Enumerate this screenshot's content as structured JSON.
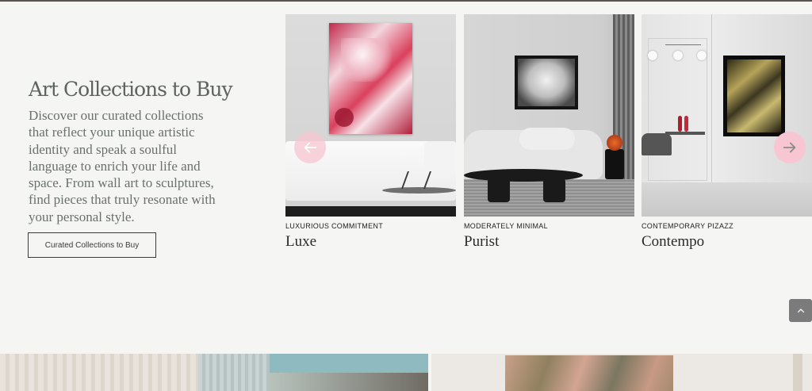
{
  "section": {
    "title": "Art Collections to Buy",
    "description": "Discover our curated collections that reflect your unique artistic identity and speak a soulful language to enrich your life and space. From wall art to sculptures, find pieces that truly resonate with your personal style.",
    "cta_label": "Curated Collections to Buy"
  },
  "collections": [
    {
      "kicker": "LUXURIOUS COMMITMENT",
      "name": "Luxe"
    },
    {
      "kicker": "MODERATELY MINIMAL",
      "name": "Purist"
    },
    {
      "kicker": "CONTEMPORARY PIZAZZ",
      "name": "Contempo"
    }
  ],
  "controls": {
    "prev_icon": "arrow-left-icon",
    "next_icon": "arrow-right-icon",
    "top_icon": "chevron-up-icon"
  },
  "colors": {
    "arrow_bg": "#f7c6d2",
    "accent_text": "#5d6460"
  }
}
